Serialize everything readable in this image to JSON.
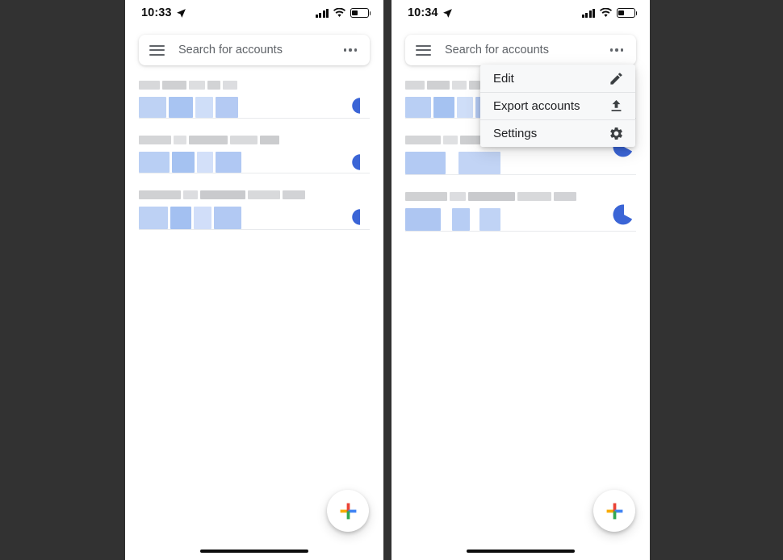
{
  "background_color": "#323232",
  "accent_color": "#3b65d6",
  "panels": [
    {
      "id": "left",
      "name": "authenticator-list-screen",
      "status_bar": {
        "time": "10:33",
        "location_icon": "location-arrow-icon",
        "signal_icon": "cellular-signal-icon",
        "wifi_icon": "wifi-icon",
        "battery_icon": "battery-low-icon",
        "battery_level": 38
      },
      "search": {
        "menu_icon": "hamburger-menu-icon",
        "placeholder": "Search for accounts",
        "overflow_icon": "more-options-icon"
      },
      "accounts": [
        {
          "issuer_redacted_width": 118,
          "code_redacted_width": 120,
          "timer_progress": 52
        },
        {
          "issuer_redacted_width": 168,
          "code_redacted_width": 128,
          "timer_progress": 50
        },
        {
          "issuer_redacted_width": 208,
          "code_redacted_width": 130,
          "timer_progress": 48
        }
      ],
      "menu_open": false,
      "fab": {
        "icon": "add-plus-icon",
        "label": ""
      },
      "home_indicator": true
    },
    {
      "id": "right",
      "name": "authenticator-overflow-menu-screen",
      "status_bar": {
        "time": "10:34",
        "location_icon": "location-arrow-icon",
        "signal_icon": "cellular-signal-icon",
        "wifi_icon": "wifi-icon",
        "battery_icon": "battery-low-icon",
        "battery_level": 38
      },
      "search": {
        "menu_icon": "hamburger-menu-icon",
        "placeholder": "Search for accounts",
        "overflow_icon": "more-options-icon"
      },
      "accounts": [
        {
          "issuer_redacted_width": 88,
          "code_redacted_width": 116,
          "timer_progress": 70
        },
        {
          "issuer_redacted_width": 180,
          "code_redacted_width": 108,
          "timer_progress": 72
        },
        {
          "issuer_redacted_width": 210,
          "code_redacted_width": 130,
          "timer_progress": 74
        }
      ],
      "menu_open": true,
      "menu": {
        "items": [
          {
            "label": "Edit",
            "icon": "pencil-edit-icon"
          },
          {
            "label": "Export accounts",
            "icon": "upload-export-icon"
          },
          {
            "label": "Settings",
            "icon": "gear-settings-icon"
          }
        ]
      },
      "fab": {
        "icon": "add-plus-icon",
        "label": ""
      },
      "home_indicator": true
    }
  ],
  "fab_colors": {
    "left": "#f9ab00",
    "top": "#ea4335",
    "right": "#4285f4",
    "bottom": "#34a853"
  }
}
